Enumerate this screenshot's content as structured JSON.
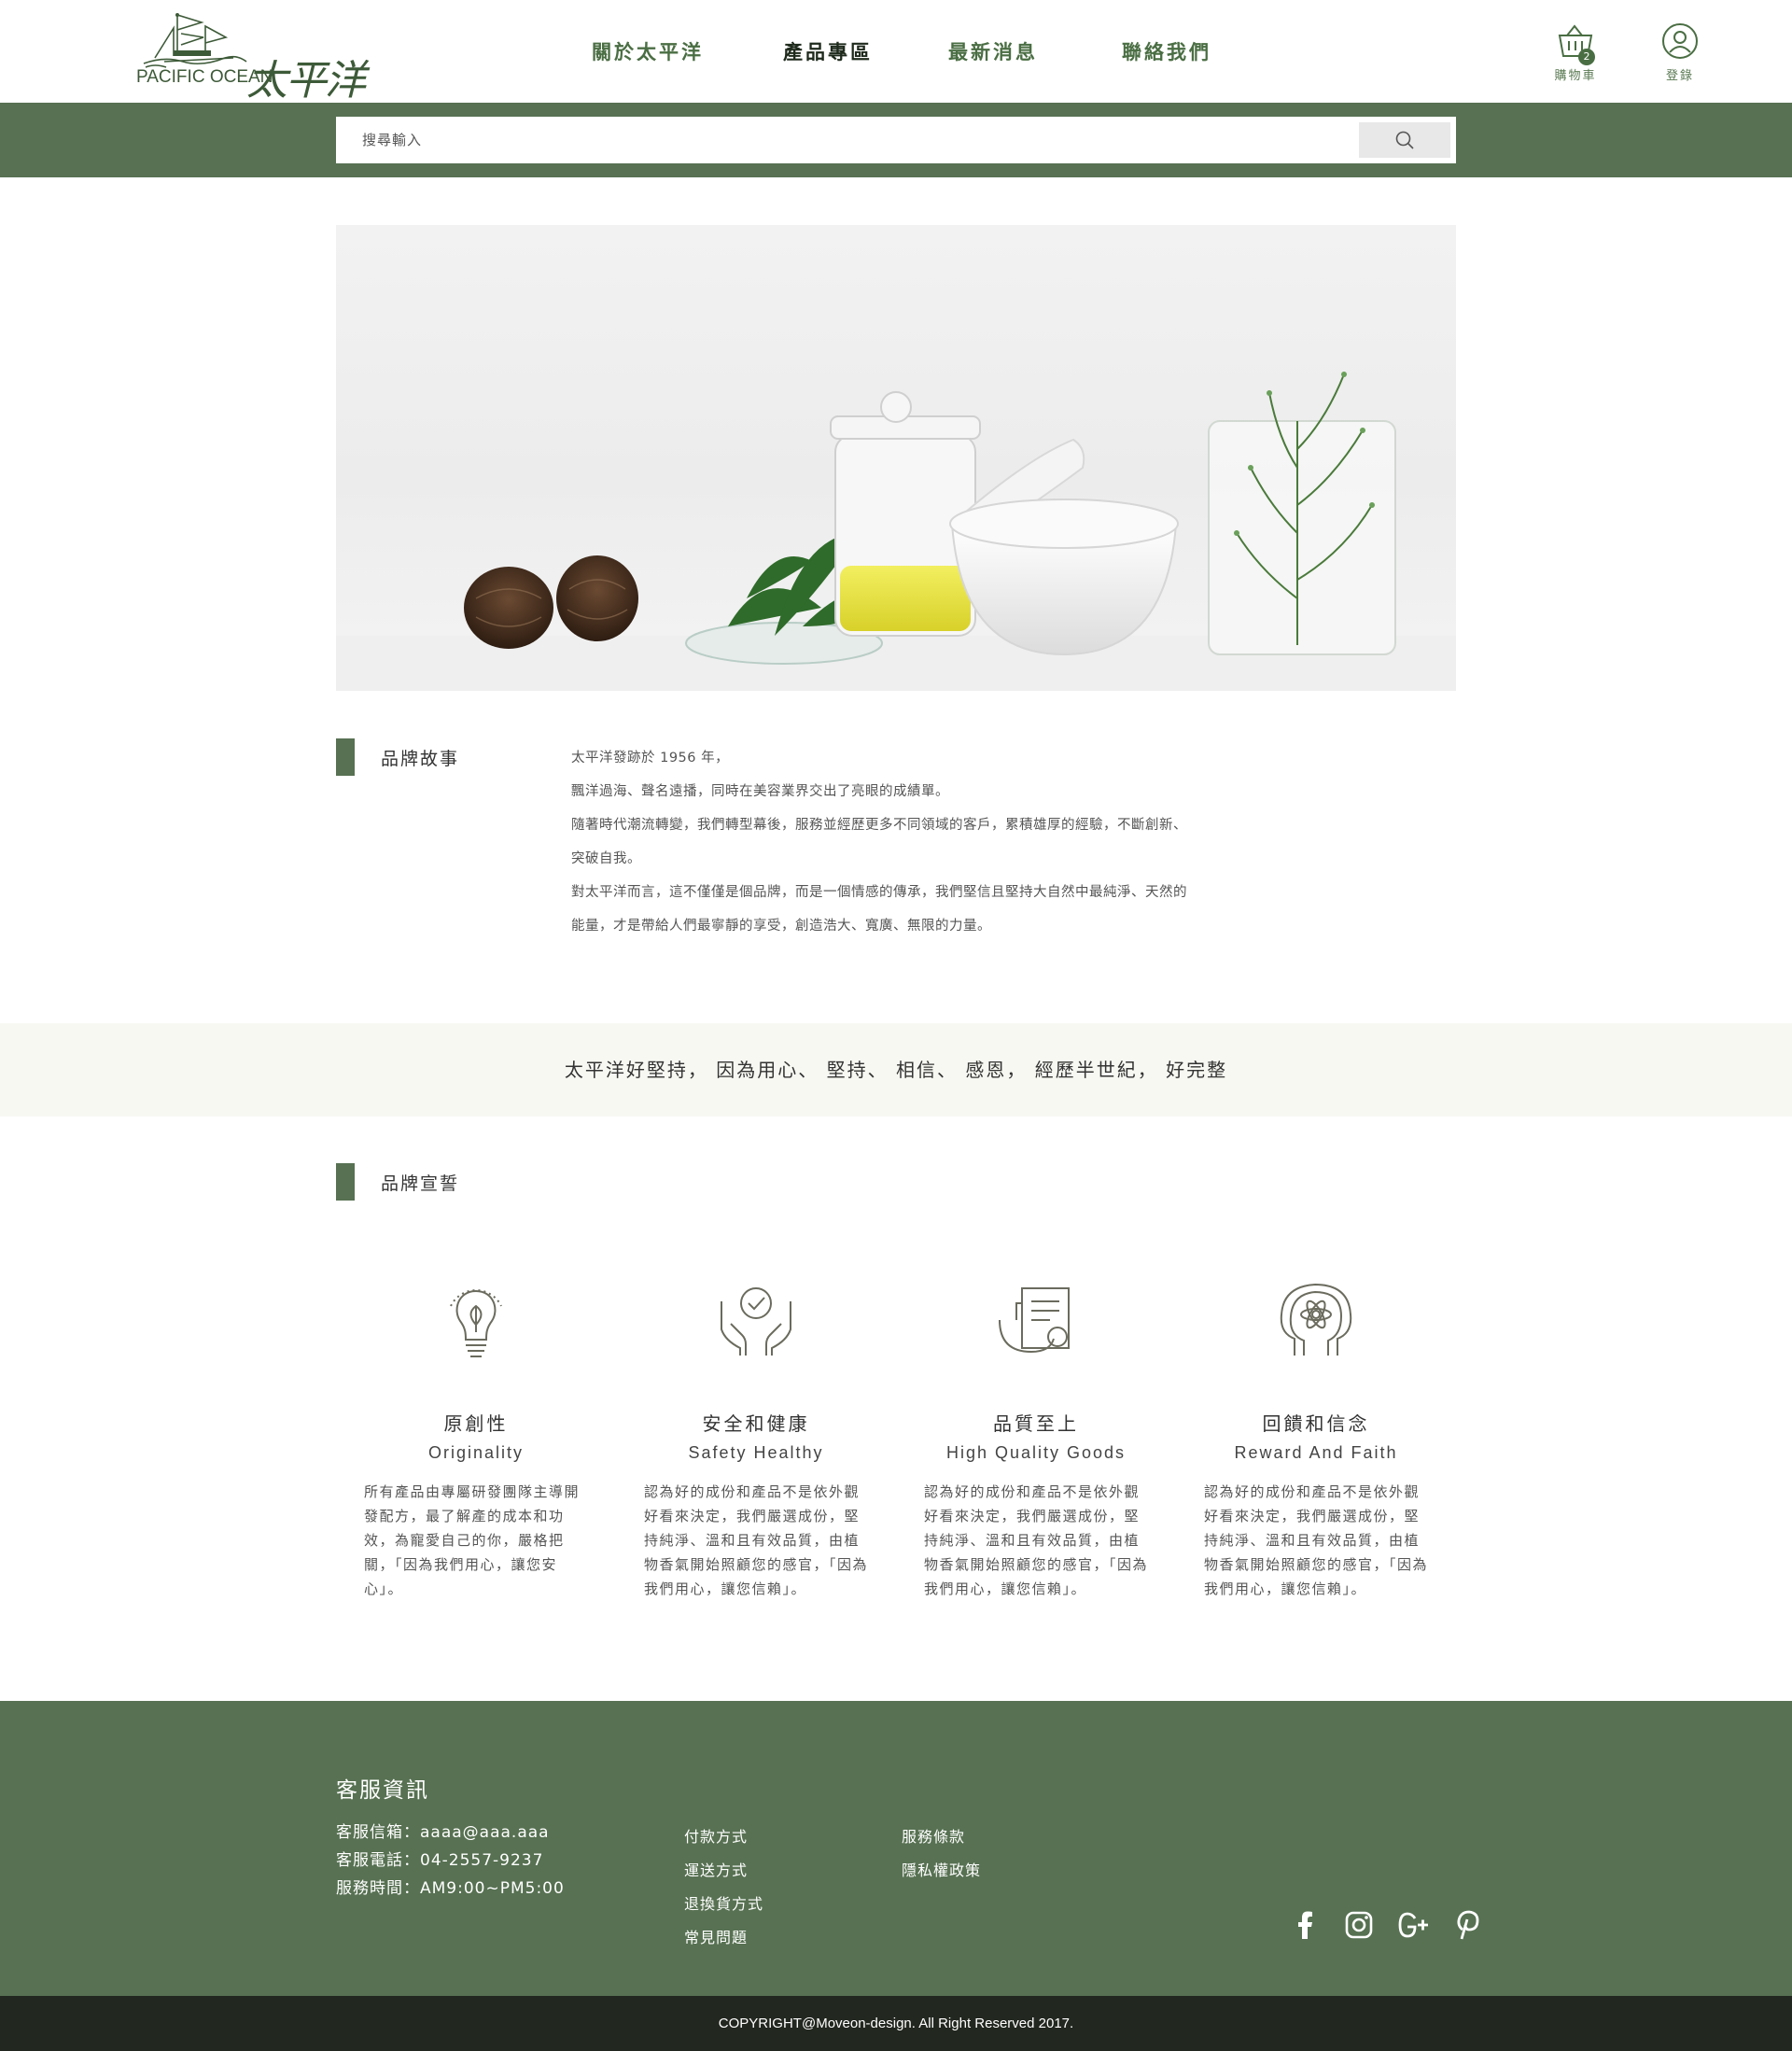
{
  "header": {
    "logo_en": "PACIFIC OCEAN",
    "logo_zh": "太平洋",
    "nav": [
      {
        "label": "關於太平洋"
      },
      {
        "label": "產品專區"
      },
      {
        "label": "最新消息"
      },
      {
        "label": "聯絡我們"
      }
    ],
    "cart": {
      "label": "購物車",
      "count": "2",
      "icon": "basket-icon"
    },
    "login": {
      "label": "登錄",
      "icon": "user-circle-icon"
    }
  },
  "search": {
    "placeholder": "搜尋輸入",
    "icon": "search-icon"
  },
  "brand_story": {
    "title": "品牌故事",
    "paragraphs": [
      "太平洋發跡於 1956 年，",
      "飄洋過海、聲名遠播，同時在美容業界交出了亮眼的成績單。",
      "隨著時代潮流轉變，我們轉型幕後，服務並經歷更多不同領域的客戶，累積雄厚的經驗，不斷創新、",
      "突破自我。",
      "對太平洋而言，這不僅僅是個品牌，而是一個情感的傳承，我們堅信且堅持大自然中最純淨、天然的",
      "能量，才是帶給人們最寧靜的享受，創造浩大、寬廣、無限的力量。"
    ]
  },
  "slogan": "太平洋好堅持， 因為用心、 堅持、 相信、 感恩， 經歷半世紀， 好完整",
  "brand_pledge": {
    "title": "品牌宣誓",
    "items": [
      {
        "icon": "lightbulb-leaf-icon",
        "title_zh": "原創性",
        "title_en": "Originality",
        "desc": "所有產品由專屬研發團隊主導開發配方，最了解產的成本和功效，為寵愛自己的你，嚴格把關，「因為我們用心，讓您安心」。"
      },
      {
        "icon": "hands-check-icon",
        "title_zh": "安全和健康",
        "title_en": "Safety Healthy",
        "desc": "認為好的成份和產品不是依外觀好看來決定，我們嚴選成份，堅持純淨、溫和且有效品質，由植物香氣開始照顧您的感官，「因為我們用心，讓您信賴」。"
      },
      {
        "icon": "quality-document-icon",
        "title_zh": "品質至上",
        "title_en": "High Quality Goods",
        "desc": "認為好的成份和產品不是依外觀好看來決定，我們嚴選成份，堅持純淨、溫和且有效品質，由植物香氣開始照顧您的感官，「因為我們用心，讓您信賴」。"
      },
      {
        "icon": "head-atom-icon",
        "title_zh": "回饋和信念",
        "title_en": "Reward And Faith",
        "desc": "認為好的成份和產品不是依外觀好看來決定，我們嚴選成份，堅持純淨、溫和且有效品質，由植物香氣開始照顧您的感官，「因為我們用心，讓您信賴」。"
      }
    ]
  },
  "footer": {
    "title": "客服資訊",
    "info": [
      "客服信箱：aaaa@aaa.aaa",
      "客服電話：04-2557-9237",
      "服務時間：AM9:00~PM5:00"
    ],
    "links_col1": [
      "付款方式",
      "運送方式",
      "退換貨方式",
      "常見問題"
    ],
    "links_col2": [
      "服務條款",
      "隱私權政策"
    ],
    "social": [
      "facebook-icon",
      "instagram-icon",
      "google-plus-icon",
      "pinterest-icon"
    ],
    "copyright": "COPYRIGHT@Moveon-design. All Right Reserved 2017."
  },
  "colors": {
    "brand_green": "#577152",
    "nav_green": "#4a6e43",
    "slogan_bg": "#f8f8f3",
    "copyright_bg": "#22271f"
  }
}
